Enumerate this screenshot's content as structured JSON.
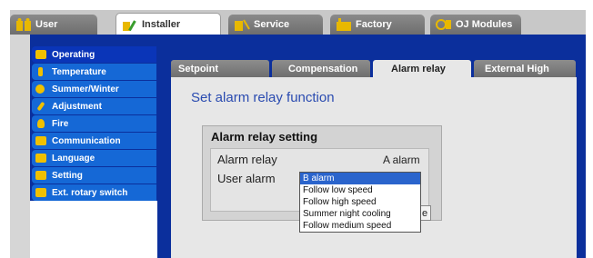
{
  "top_tabs": [
    {
      "label": "User",
      "icon": "user-icon",
      "color": "#e8b800"
    },
    {
      "label": "Installer",
      "icon": "installer-icon",
      "color": "#e8b800"
    },
    {
      "label": "Service",
      "icon": "service-icon",
      "color": "#e8b800"
    },
    {
      "label": "Factory",
      "icon": "factory-icon",
      "color": "#e8b800"
    },
    {
      "label": "OJ Modules",
      "icon": "modules-icon",
      "color": "#e8b800"
    }
  ],
  "active_top_tab": "Installer",
  "sidebar": {
    "items": [
      {
        "label": "Operating",
        "icon": "operating-icon"
      },
      {
        "label": "Temperature",
        "icon": "temperature-icon"
      },
      {
        "label": "Summer/Winter",
        "icon": "sun-icon"
      },
      {
        "label": "Adjustment",
        "icon": "adjustment-icon"
      },
      {
        "label": "Fire",
        "icon": "fire-icon"
      },
      {
        "label": "Communication",
        "icon": "communication-icon"
      },
      {
        "label": "Language",
        "icon": "language-icon"
      },
      {
        "label": "Setting",
        "icon": "setting-icon"
      },
      {
        "label": "Ext. rotary switch",
        "icon": "rotary-switch-icon"
      }
    ],
    "selected": "Operating"
  },
  "sub_tabs": [
    {
      "label": "Setpoint"
    },
    {
      "label": "Compensation"
    },
    {
      "label": "Alarm relay"
    },
    {
      "label": "External High"
    }
  ],
  "active_sub_tab": "Alarm relay",
  "main": {
    "heading": "Set alarm relay function",
    "group_title": "Alarm relay setting",
    "rows": [
      {
        "label": "Alarm relay",
        "value": "A alarm"
      },
      {
        "label": "User alarm",
        "value": ""
      }
    ],
    "button_fragment": "e"
  },
  "dropdown": {
    "options": [
      "B alarm",
      "Follow low speed",
      "Follow high speed",
      "Summer night cooling",
      "Follow medium speed"
    ],
    "selected": "B alarm"
  },
  "colors": {
    "accent_blue": "#0b2f9c",
    "menu_blue": "#1568d6",
    "heading_blue": "#2a4bb0",
    "dropdown_highlight": "#2a64cc"
  }
}
